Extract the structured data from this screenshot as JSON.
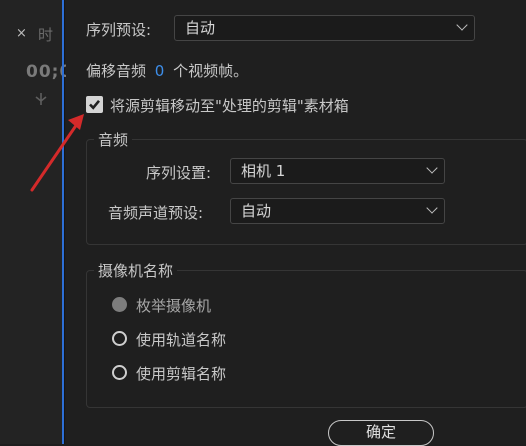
{
  "background_panel": {
    "close_glyph": "×",
    "tab_label": "时",
    "timecode": "00;0",
    "snap_icon": "snap-icon"
  },
  "dialog": {
    "sequence_preset": {
      "label": "序列预设:",
      "value": "自动"
    },
    "offset_audio": {
      "prefix": "偏移音频",
      "value": "0",
      "suffix": "个视频帧。"
    },
    "move_source_clips": {
      "label": "将源剪辑移动至\"处理的剪辑\"素材箱",
      "checked": true
    },
    "audio_group": {
      "title": "音频",
      "sequence_settings": {
        "label": "序列设置:",
        "value": "相机 1"
      },
      "audio_channel_preset": {
        "label": "音频声道预设:",
        "value": "自动"
      }
    },
    "camera_name_group": {
      "title": "摄像机名称",
      "options": [
        {
          "label": "枚举摄像机",
          "selected": true
        },
        {
          "label": "使用轨道名称",
          "selected": false
        },
        {
          "label": "使用剪辑名称",
          "selected": false
        }
      ]
    },
    "ok_button": "确定"
  },
  "colors": {
    "accent_blue": "#2d6fd6",
    "annotation_red": "#d42a2a",
    "dialog_bg": "#1f1f1f"
  }
}
